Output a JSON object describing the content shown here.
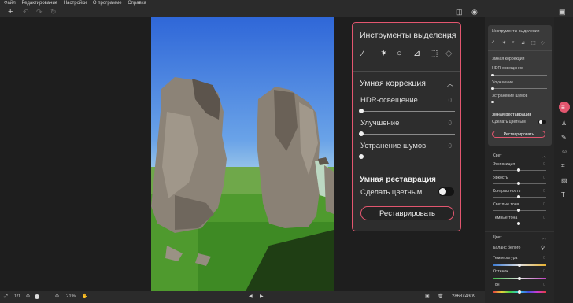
{
  "menu": [
    "Файл",
    "Редактирование",
    "Настройки",
    "О программе",
    "Справка"
  ],
  "toolbar": {
    "add_icon": "+",
    "undo_icon": "↶",
    "redo_icon": "↷",
    "reset_icon": "↻",
    "compare_icon": "◫",
    "eye_icon": "◉",
    "save_icon": "▣"
  },
  "popup": {
    "selection_title": "Инструменты выделения",
    "tools": [
      "brush",
      "magic-wand",
      "lasso",
      "polygon-lasso",
      "rect-select",
      "eraser"
    ],
    "tool_glyphs": [
      "⁄",
      "✶",
      "○",
      "⊿",
      "⬚",
      "◇"
    ],
    "smart_title": "Умная коррекция",
    "sliders": [
      {
        "label": "HDR-освещение",
        "value": "0"
      },
      {
        "label": "Улучшение",
        "value": "0"
      },
      {
        "label": "Устранение шумов",
        "value": "0"
      }
    ],
    "restore_title": "Умная реставрация",
    "colorize_label": "Сделать цветным",
    "colorize_on": false,
    "restore_button": "Реставрировать"
  },
  "mini_panel": {
    "selection_title": "Инструменты выделения",
    "smart_title": "Умная коррекция",
    "items": [
      "HDR-освещение",
      "Улучшение",
      "Устранение шумов"
    ],
    "restore_title": "Умная реставрация",
    "colorize_label": "Сделать цветным",
    "restore_button": "Реставрировать"
  },
  "light_section": {
    "title": "Свет",
    "items": [
      "Экспозиция",
      "Яркость",
      "Контрастность",
      "Светлые тона",
      "Темные тона"
    ],
    "values": [
      "0",
      "0",
      "0",
      "0",
      "0"
    ]
  },
  "color_section": {
    "title": "Цвет",
    "white_balance": "Баланс белого",
    "items": [
      "Температура",
      "Оттенок",
      "Тон"
    ],
    "values": [
      "0",
      "0",
      "0"
    ]
  },
  "bottom": {
    "page": "1/1",
    "zoom": "21%",
    "dimensions": "2868×4309",
    "prev_icon": "◀",
    "next_icon": "▶"
  },
  "strip_icons": [
    "adjust-icon",
    "stamp-icon",
    "paint-icon",
    "face-icon",
    "crop-icon",
    "frame-icon",
    "text-icon"
  ],
  "colors": {
    "accent": "#e3566f",
    "panel": "#2d2d2d",
    "background": "#1e1e1e"
  }
}
